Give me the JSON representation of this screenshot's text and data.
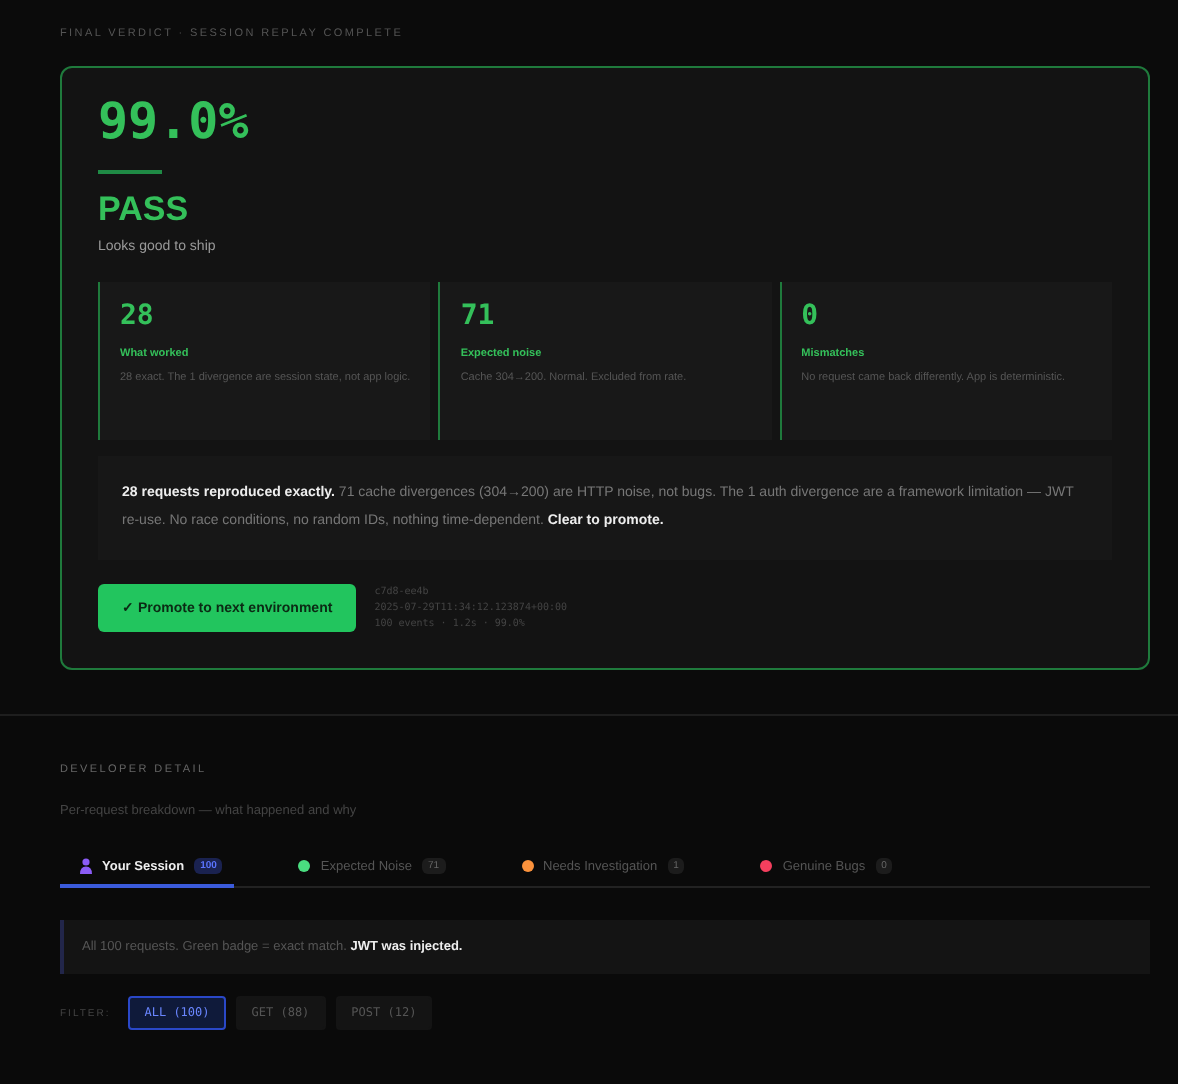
{
  "header": "FINAL VERDICT · SESSION REPLAY COMPLETE",
  "verdict": {
    "score": "99.0%",
    "status": "PASS",
    "subtitle": "Looks good to ship"
  },
  "stats": [
    {
      "value": "28",
      "label": "What worked",
      "note": "28 exact. The 1 divergence are session state, not app logic."
    },
    {
      "value": "71",
      "label": "Expected noise",
      "note": "Cache 304→200. Normal. Excluded from rate."
    },
    {
      "value": "0",
      "label": "Mismatches",
      "note": "No request came back differently. App is deterministic."
    }
  ],
  "summary": "**28 requests reproduced exactly.** 71 cache divergences (304→200) are HTTP noise, not bugs. The 1 auth divergence are a framework limitation — JWT re-use. No race conditions, no random IDs, nothing time-dependent. **Clear to promote.**",
  "promote_button": "✓ Promote to next environment",
  "meta": [
    "c7d8-ee4b",
    "2025-07-29T11:34:12.123874+00:00",
    "100 events · 1.2s · 99.0%"
  ],
  "developer": {
    "heading": "DEVELOPER DETAIL",
    "subtitle": "Per-request breakdown — what happened and why",
    "tabs": [
      {
        "label": "Your Session",
        "count": "100",
        "kind": "person",
        "color": "#8b5cf6",
        "selected": true
      },
      {
        "label": "Expected Noise",
        "count": "71",
        "kind": "dot",
        "color": "#4ade80",
        "selected": false
      },
      {
        "label": "Needs Investigation",
        "count": "1",
        "kind": "dot",
        "color": "#fb923c",
        "selected": false
      },
      {
        "label": "Genuine Bugs",
        "count": "0",
        "kind": "dot",
        "color": "#f43f5e",
        "selected": false
      }
    ],
    "note": "All 100 requests. Green badge = exact match. **JWT was injected.**",
    "filter_label": "FILTER:",
    "filters": [
      {
        "label": "ALL (100)",
        "selected": true
      },
      {
        "label": "GET (88)",
        "selected": false
      },
      {
        "label": "POST (12)",
        "selected": false
      }
    ]
  }
}
